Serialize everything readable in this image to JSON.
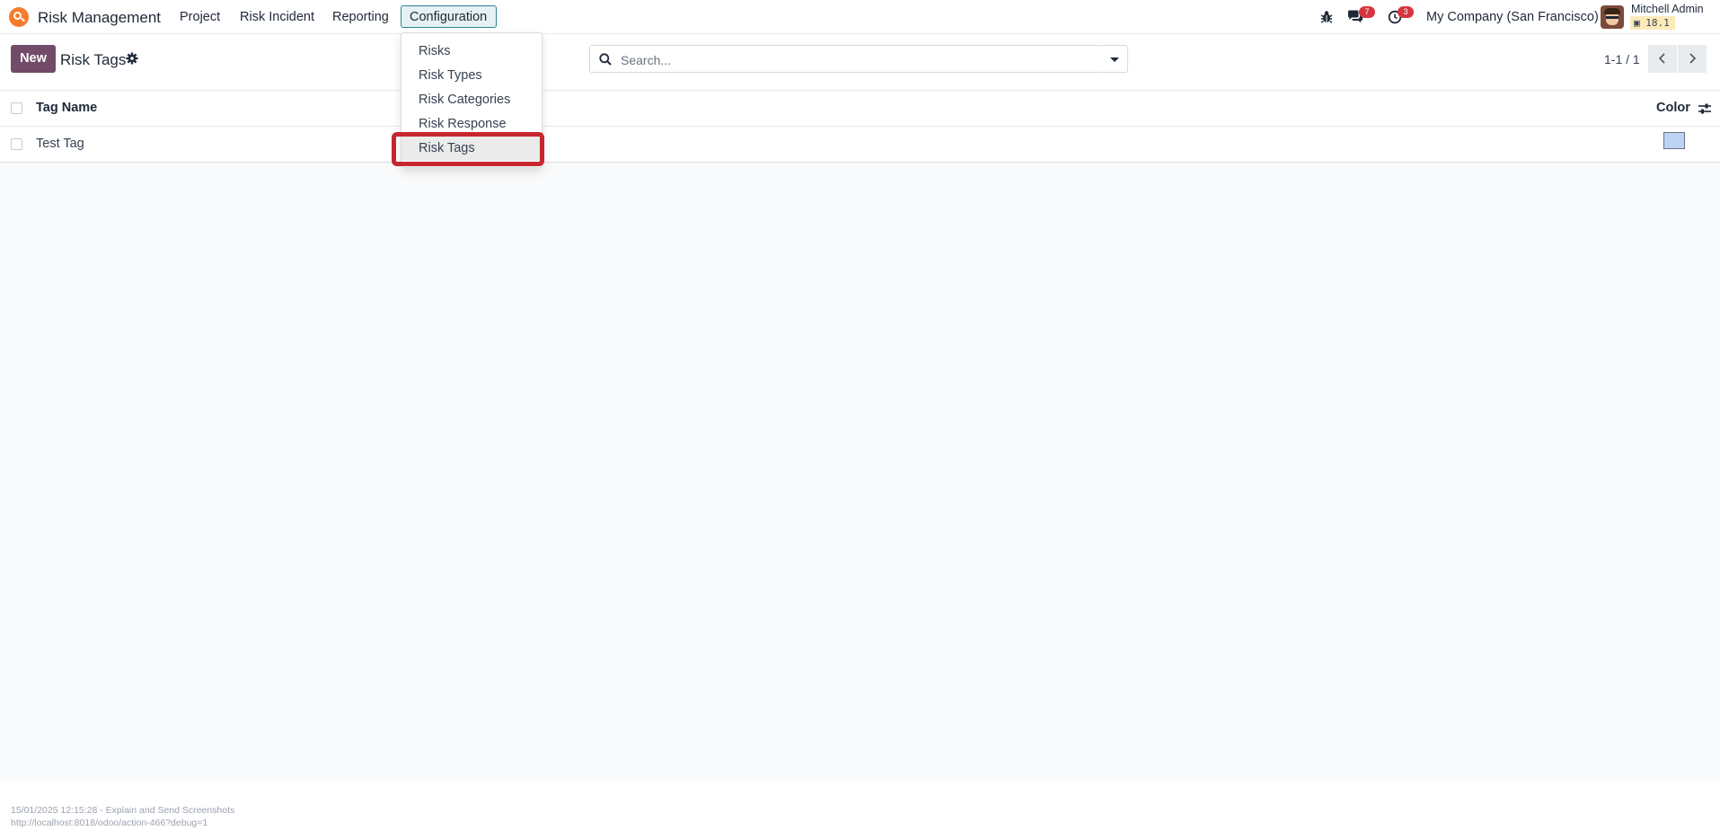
{
  "navbar": {
    "app_name": "Risk Management",
    "menu": [
      "Project",
      "Risk Incident",
      "Reporting",
      "Configuration"
    ],
    "messages_count": "7",
    "activities_count": "3",
    "company": "My Company (San Francisco)",
    "user_name": "Mitchell Admin",
    "db_version": "18.1",
    "logo_color": "#f47c2c"
  },
  "dropdown": {
    "items": [
      "Risks",
      "Risk Types",
      "Risk Categories",
      "Risk Response",
      "Risk Tags"
    ],
    "active_item": "Risk Tags"
  },
  "control_panel": {
    "new_label": "New",
    "title": "Risk Tags",
    "search_placeholder": "Search...",
    "pager": "1-1 / 1"
  },
  "list": {
    "columns": [
      "Tag Name",
      "Color"
    ],
    "rows": [
      {
        "tag_name": "Test Tag",
        "color": "#bcd3f5"
      }
    ]
  },
  "footer": {
    "line1": "15/01/2025 12:15:28 - Explain and Send Screenshots",
    "line2": "http://localhost:8018/odoo/action-466?debug=1"
  },
  "colors": {
    "primary": "#714b67",
    "highlight": "#c8262e",
    "badge": "#d6363f",
    "config_active_border": "#2c8397"
  }
}
